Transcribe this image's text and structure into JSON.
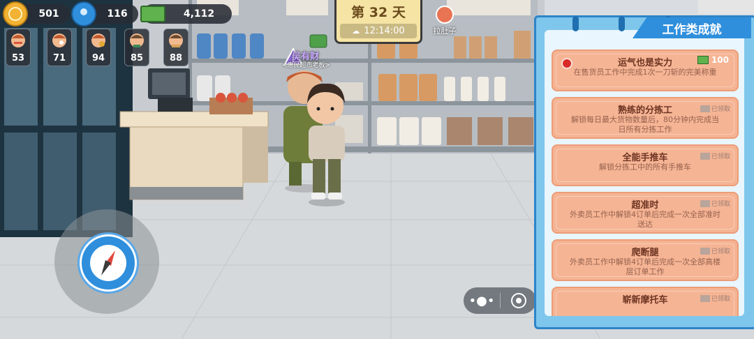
{
  "hud": {
    "coins": "501",
    "people": "116",
    "cash": "4,112",
    "stats": [
      "53",
      "71",
      "94",
      "85",
      "88"
    ]
  },
  "day": {
    "label": "第 32 天",
    "time": "12:14:00"
  },
  "status_effect": {
    "label": "拉肚子"
  },
  "npc": {
    "name": "吴有财",
    "title": "<惠民超市老板>"
  },
  "panel": {
    "title": "工作类成就",
    "achievements": [
      {
        "title": "运气也是实力",
        "desc": "在售货员工作中完成1次一刀斩的完美称重",
        "reward": "100",
        "status": ""
      },
      {
        "title": "熟练的分拣工",
        "desc": "解锁每日最大货物数量后，80分钟内完成当日所有分拣工作",
        "reward": "",
        "status": "已领取"
      },
      {
        "title": "全能手推车",
        "desc": "解锁分拣工中的所有手推车",
        "reward": "",
        "status": "已领取"
      },
      {
        "title": "超准时",
        "desc": "外卖员工作中解锁4订单后完成一次全部准时送达",
        "reward": "",
        "status": "已领取"
      },
      {
        "title": "爬断腿",
        "desc": "外卖员工作中解锁4订单后完成一次全部高楼层订单工作",
        "reward": "",
        "status": "已领取"
      },
      {
        "title": "崭新摩托车",
        "desc": "",
        "reward": "",
        "status": "已领取"
      }
    ]
  }
}
